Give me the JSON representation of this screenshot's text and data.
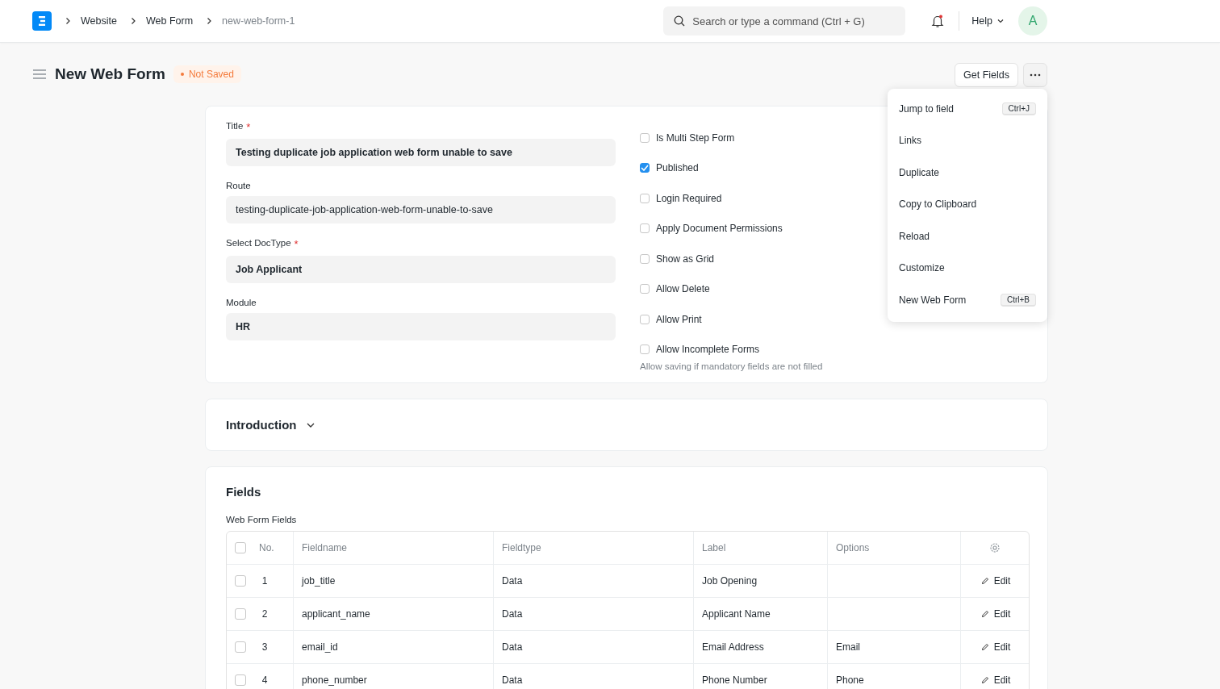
{
  "breadcrumbs": [
    {
      "label": "Website",
      "current": false
    },
    {
      "label": "Web Form",
      "current": false
    },
    {
      "label": "new-web-form-1",
      "current": true
    }
  ],
  "search": {
    "placeholder": "Search or type a command (Ctrl + G)"
  },
  "notifications": {
    "unread": true
  },
  "help": {
    "label": "Help"
  },
  "avatar": {
    "initial": "A"
  },
  "page": {
    "title": "New Web Form",
    "status": "Not Saved",
    "buttons": [
      "Get Fields"
    ]
  },
  "menu": [
    {
      "label": "Jump to field",
      "shortcut": "Ctrl+J"
    },
    {
      "label": "Links"
    },
    {
      "label": "Duplicate"
    },
    {
      "label": "Copy to Clipboard"
    },
    {
      "label": "Reload"
    },
    {
      "label": "Customize"
    },
    {
      "label": "New Web Form",
      "shortcut": "Ctrl+B"
    }
  ],
  "fields": [
    {
      "label": "Title",
      "required_mark": "*",
      "value": "Testing duplicate job application web form unable to save",
      "bold": true
    },
    {
      "label": "Route",
      "value": "testing-duplicate-job-application-web-form-unable-to-save",
      "bold": false
    },
    {
      "label": "Select DocType",
      "required_mark": "*",
      "value": "Job Applicant",
      "bold": true
    },
    {
      "label": "Module",
      "value": "HR",
      "bold": true
    }
  ],
  "checkboxes": [
    {
      "label": "Is Multi Step Form",
      "checked": false
    },
    {
      "label": "Published",
      "checked": true
    },
    {
      "label": "Login Required",
      "checked": false
    },
    {
      "label": "Apply Document Permissions",
      "checked": false
    },
    {
      "label": "Show as Grid",
      "checked": false
    },
    {
      "label": "Allow Delete",
      "checked": false
    },
    {
      "label": "Allow Print",
      "checked": false
    },
    {
      "label": "Allow Incomplete Forms",
      "checked": false,
      "description": "Allow saving if mandatory fields are not filled"
    }
  ],
  "introduction": {
    "title": "Introduction",
    "expanded": false
  },
  "fields_section": {
    "title": "Fields",
    "table_label": "Web Form Fields",
    "all_checked": false,
    "columns": [
      "No.",
      "Fieldname",
      "Fieldtype",
      "Label",
      "Options"
    ],
    "rows": [
      {
        "no": "1",
        "fieldname": "job_title",
        "fieldtype": "Data",
        "label": "Job Opening",
        "action": "Edit",
        "checked": false
      },
      {
        "no": "2",
        "fieldname": "applicant_name",
        "fieldtype": "Data",
        "label": "Applicant Name",
        "action": "Edit",
        "checked": false
      },
      {
        "no": "3",
        "fieldname": "email_id",
        "fieldtype": "Data",
        "label": "Email Address",
        "options": "Email",
        "action": "Edit",
        "checked": false
      },
      {
        "no": "4",
        "fieldname": "phone_number",
        "fieldtype": "Data",
        "label": "Phone Number",
        "options": "Phone",
        "action": "Edit",
        "checked": false
      }
    ]
  }
}
